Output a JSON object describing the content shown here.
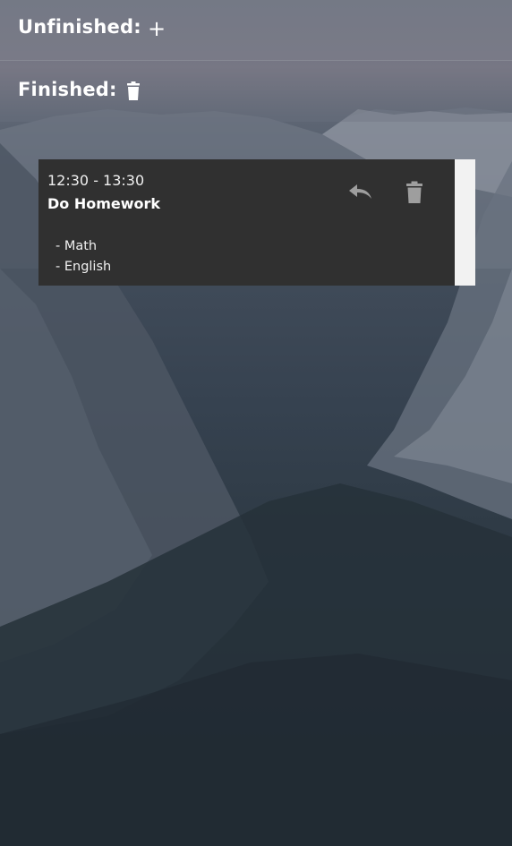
{
  "sections": {
    "unfinished": {
      "title": "Unfinished:",
      "action_icon": "plus-icon",
      "action_glyph": "+"
    },
    "finished": {
      "title": "Finished:",
      "action_icon": "trash-icon"
    }
  },
  "task": {
    "time": "12:30 - 13:30",
    "title": "Do Homework",
    "notes": [
      "- Math",
      "- English"
    ],
    "actions": [
      "undo-icon",
      "trash-icon"
    ]
  },
  "colors": {
    "card_background": "#303030",
    "card_stripe": "#f2f2f2",
    "icon_gray": "#9e9e9e"
  }
}
